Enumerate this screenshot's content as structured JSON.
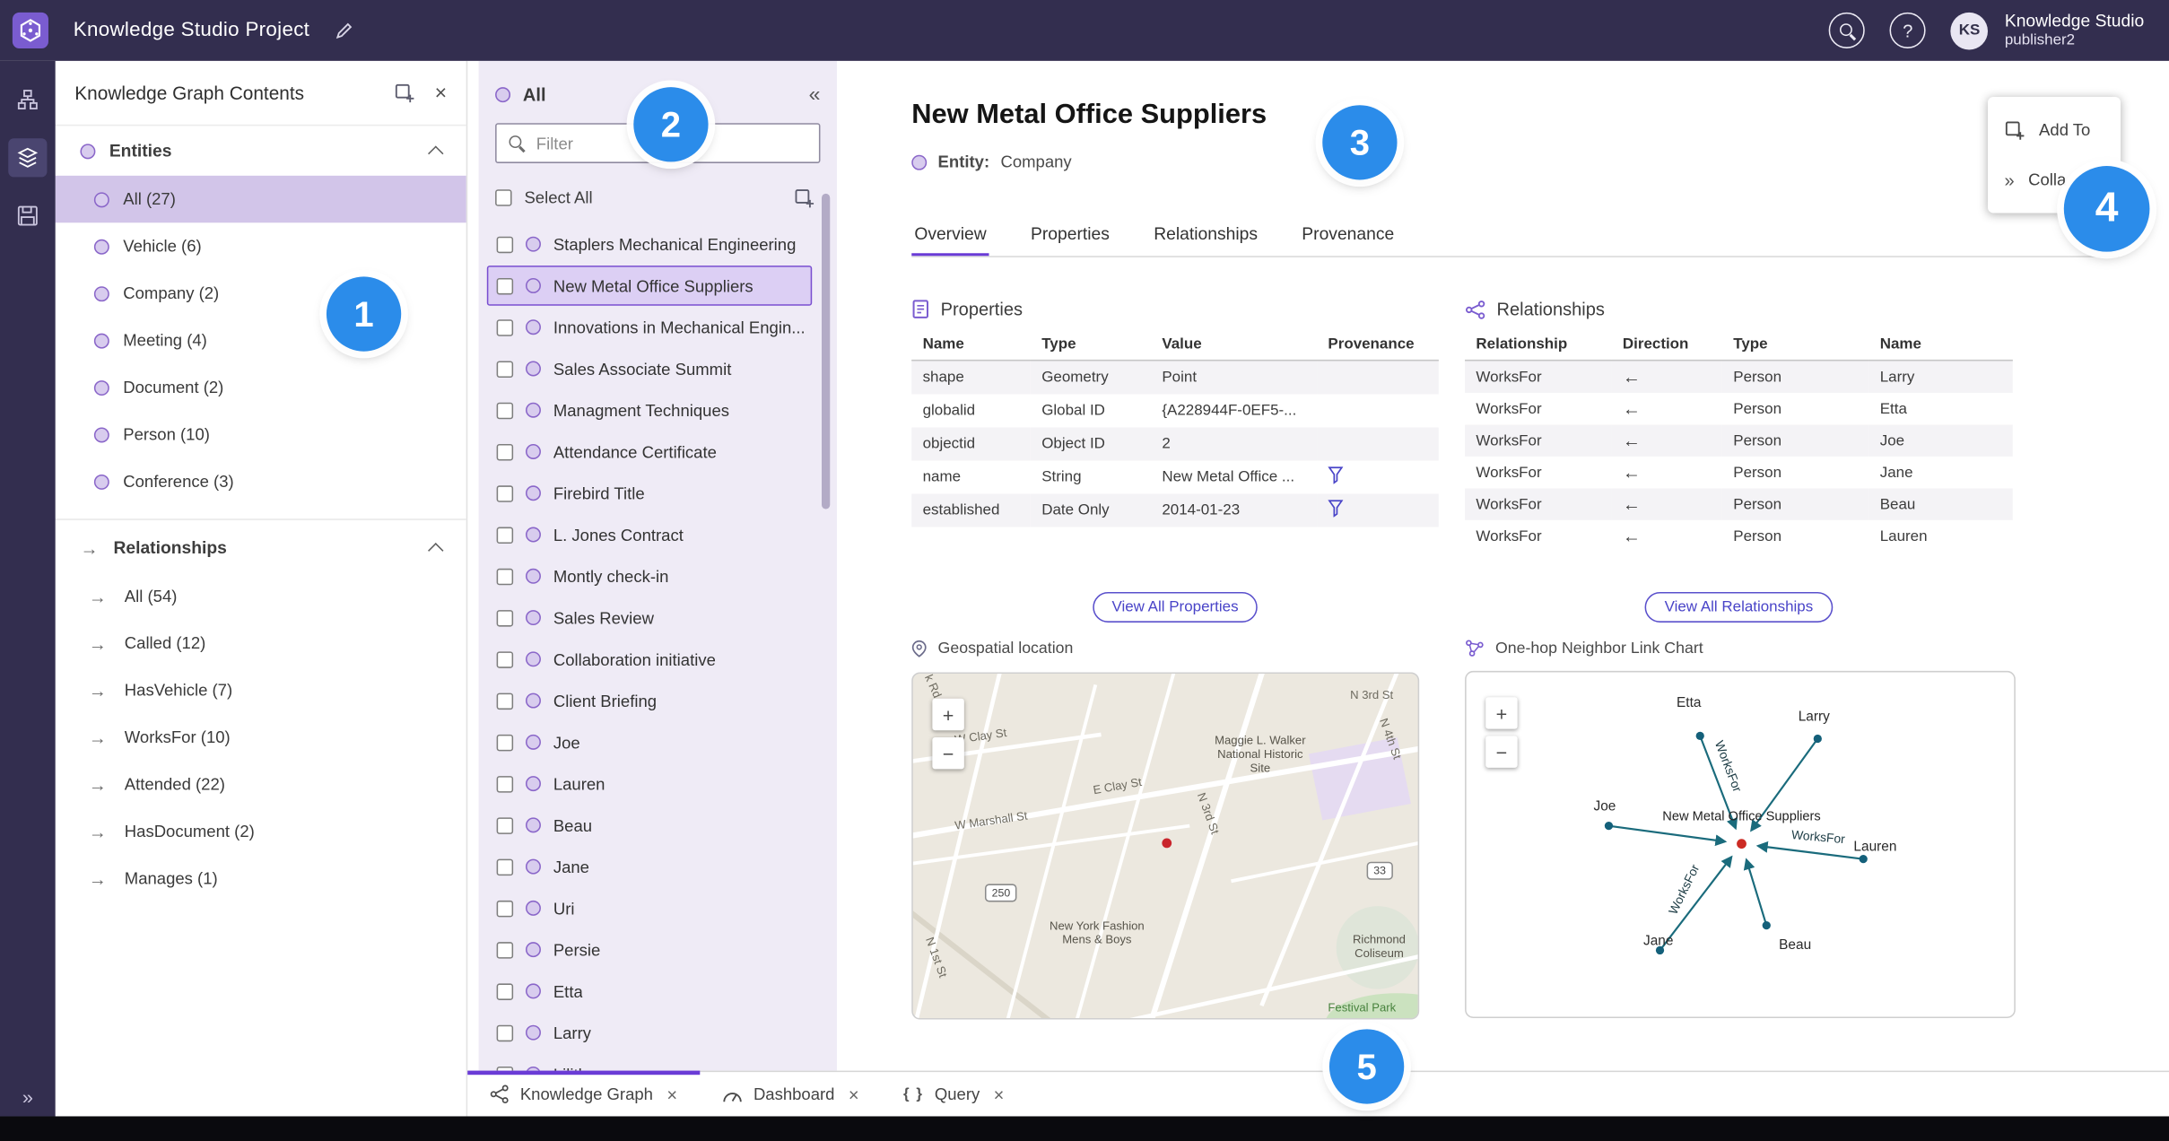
{
  "icons": {
    "close": "×",
    "collapse_left": "«",
    "expand_right": "»",
    "arrow_right": "→",
    "help": "?",
    "query_braces": "{ }"
  },
  "header": {
    "app_title": "Knowledge Studio Project",
    "user_name": "Knowledge Studio",
    "user_role": "publisher2",
    "avatar_initials": "KS"
  },
  "contents_panel": {
    "title": "Knowledge Graph Contents",
    "entities_header": "Entities",
    "entities": [
      {
        "label": "All (27)",
        "selected": true
      },
      {
        "label": "Vehicle (6)",
        "selected": false
      },
      {
        "label": "Company (2)",
        "selected": false
      },
      {
        "label": "Meeting (4)",
        "selected": false
      },
      {
        "label": "Document (2)",
        "selected": false
      },
      {
        "label": "Person (10)",
        "selected": false
      },
      {
        "label": "Conference (3)",
        "selected": false
      }
    ],
    "relationships_header": "Relationships",
    "relationships": [
      {
        "label": "All (54)"
      },
      {
        "label": "Called (12)"
      },
      {
        "label": "HasVehicle (7)"
      },
      {
        "label": "WorksFor (10)"
      },
      {
        "label": "Attended (22)"
      },
      {
        "label": "HasDocument (2)"
      },
      {
        "label": "Manages (1)"
      }
    ]
  },
  "list_panel": {
    "title": "All",
    "filter_placeholder": "Filter",
    "select_all": "Select All",
    "items": [
      {
        "label": "Staplers Mechanical Engineering",
        "selected": false
      },
      {
        "label": "New Metal Office Suppliers",
        "selected": true
      },
      {
        "label": "Innovations in Mechanical Engin...",
        "selected": false
      },
      {
        "label": "Sales Associate Summit",
        "selected": false
      },
      {
        "label": "Managment Techniques",
        "selected": false
      },
      {
        "label": "Attendance Certificate",
        "selected": false
      },
      {
        "label": "Firebird Title",
        "selected": false
      },
      {
        "label": "L. Jones Contract",
        "selected": false
      },
      {
        "label": "Montly check-in",
        "selected": false
      },
      {
        "label": "Sales Review",
        "selected": false
      },
      {
        "label": "Collaboration initiative",
        "selected": false
      },
      {
        "label": "Client Briefing",
        "selected": false
      },
      {
        "label": "Joe",
        "selected": false
      },
      {
        "label": "Lauren",
        "selected": false
      },
      {
        "label": "Beau",
        "selected": false
      },
      {
        "label": "Jane",
        "selected": false
      },
      {
        "label": "Uri",
        "selected": false
      },
      {
        "label": "Persie",
        "selected": false
      },
      {
        "label": "Etta",
        "selected": false
      },
      {
        "label": "Larry",
        "selected": false
      },
      {
        "label": "Lilith",
        "selected": false
      }
    ]
  },
  "detail": {
    "title": "New Metal Office Suppliers",
    "entity_prefix": "Entity:",
    "entity_type": "Company",
    "tabs": [
      {
        "label": "Overview",
        "active": true
      },
      {
        "label": "Properties",
        "active": false
      },
      {
        "label": "Relationships",
        "active": false
      },
      {
        "label": "Provenance",
        "active": false
      }
    ],
    "properties": {
      "heading": "Properties",
      "col_name": "Name",
      "col_type": "Type",
      "col_value": "Value",
      "col_provenance": "Provenance",
      "rows": [
        {
          "name": "shape",
          "type": "Geometry",
          "value": "Point",
          "prov": false
        },
        {
          "name": "globalid",
          "type": "Global ID",
          "value": "{A228944F-0EF5-...",
          "prov": false
        },
        {
          "name": "objectid",
          "type": "Object ID",
          "value": "2",
          "prov": false
        },
        {
          "name": "name",
          "type": "String",
          "value": "New Metal Office ...",
          "prov": true
        },
        {
          "name": "established",
          "type": "Date Only",
          "value": "2014-01-23",
          "prov": true
        }
      ],
      "view_all": "View All Properties"
    },
    "relationships": {
      "heading": "Relationships",
      "col_relationship": "Relationship",
      "col_direction": "Direction",
      "col_type": "Type",
      "col_name": "Name",
      "rows": [
        {
          "relationship": "WorksFor",
          "direction": "←",
          "type": "Person",
          "name": "Larry"
        },
        {
          "relationship": "WorksFor",
          "direction": "←",
          "type": "Person",
          "name": "Etta"
        },
        {
          "relationship": "WorksFor",
          "direction": "←",
          "type": "Person",
          "name": "Joe"
        },
        {
          "relationship": "WorksFor",
          "direction": "←",
          "type": "Person",
          "name": "Jane"
        },
        {
          "relationship": "WorksFor",
          "direction": "←",
          "type": "Person",
          "name": "Beau"
        },
        {
          "relationship": "WorksFor",
          "direction": "←",
          "type": "Person",
          "name": "Lauren"
        }
      ],
      "view_all": "View All Relationships"
    },
    "geospatial": {
      "heading": "Geospatial location",
      "zoom_in": "+",
      "zoom_out": "−",
      "map_labels": {
        "k_rd": "k Rd",
        "w_clay": "W Clay St",
        "e_clay": "E Clay St",
        "w_marshall": "W Marshall St",
        "n_3rd_top": "N 3rd St",
        "n_3rd_mid": "N 3rd St",
        "n_4th": "N 4th St",
        "n_1st": "N 1st St",
        "maggie": "Maggie L. Walker National Historic Site",
        "ny_fashion": "New York Fashion Mens & Boys",
        "coliseum": "Richmond Coliseum",
        "festival": "Festival Park",
        "shield_250": "250",
        "shield_33": "33"
      }
    },
    "link_chart": {
      "heading": "One-hop Neighbor Link Chart",
      "center": "New Metal Office Suppliers",
      "edge_label": "WorksFor",
      "nodes": [
        "Etta",
        "Larry",
        "Joe",
        "Jane",
        "Beau",
        "Lauren"
      ],
      "zoom_in": "+",
      "zoom_out": "−"
    }
  },
  "popup": {
    "add_to": "Add To",
    "collapse": "Colla"
  },
  "bottom_tabs": [
    {
      "label": "Knowledge Graph",
      "active": true
    },
    {
      "label": "Dashboard",
      "active": false
    },
    {
      "label": "Query",
      "active": false
    }
  ],
  "callouts": [
    "1",
    "2",
    "3",
    "4",
    "5"
  ]
}
